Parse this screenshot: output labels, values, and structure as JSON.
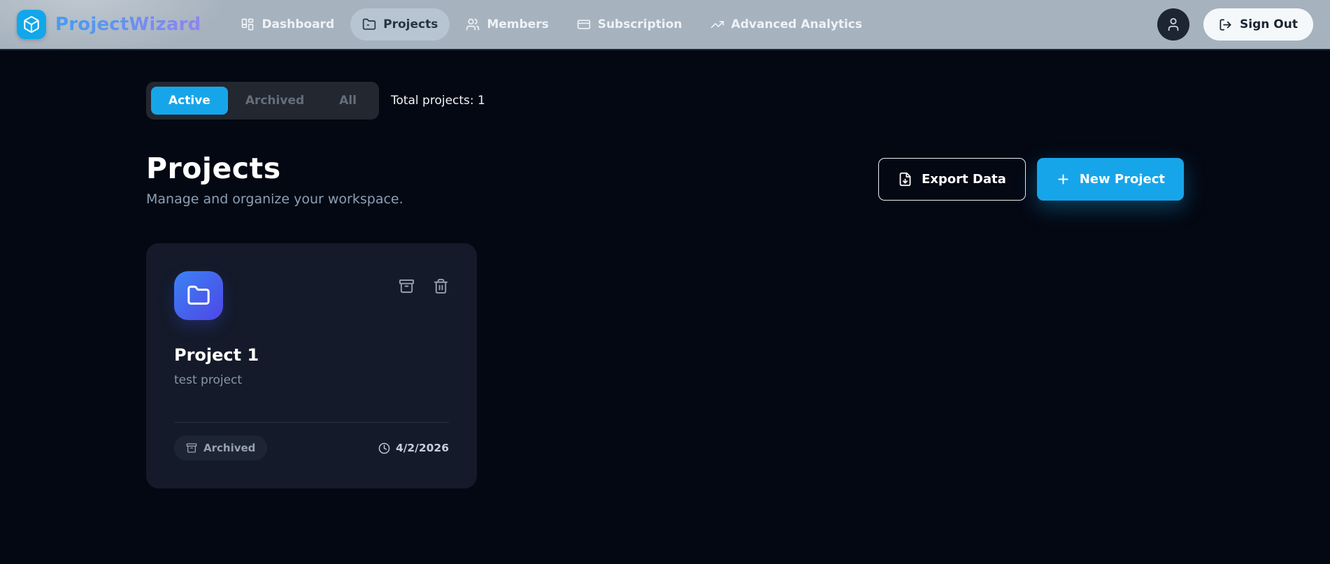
{
  "app": {
    "brand": "ProjectWizard"
  },
  "header": {
    "nav": [
      {
        "label": "Dashboard"
      },
      {
        "label": "Projects"
      },
      {
        "label": "Members"
      },
      {
        "label": "Subscription"
      },
      {
        "label": "Advanced Analytics"
      }
    ],
    "active_nav": "Projects",
    "sign_out_label": "Sign Out"
  },
  "filters": {
    "tabs": [
      {
        "label": "Active",
        "active": true
      },
      {
        "label": "Archived",
        "active": false
      },
      {
        "label": "All",
        "active": false
      }
    ],
    "total_label": "Total projects: 1"
  },
  "page": {
    "title": "Projects",
    "subtitle": "Manage and organize your workspace.",
    "buttons": {
      "export": "Export Data",
      "new_project": "New Project"
    }
  },
  "projects": [
    {
      "name": "Project 1",
      "description": "test project",
      "status_badge": "Archived",
      "date": "4/2/2026"
    }
  ],
  "icons": {
    "logo": "package-cube-icon",
    "nav": [
      "dashboard-grid-icon",
      "folder-icon",
      "users-icon",
      "credit-card-icon",
      "trending-up-icon"
    ],
    "card_actions": [
      "archive-icon",
      "trash-icon"
    ]
  },
  "colors": {
    "accent_blue": "#17a5ea",
    "logo_cyan": "#12a7ea",
    "header_bg": "#a6b2be",
    "page_bg": "#040813",
    "card_bg": "#141a29",
    "brand_gradient_start": "#4a9bf0",
    "brand_gradient_end": "#8d85f0",
    "folder_gradient_start": "#3b82f6",
    "folder_gradient_end": "#4f46e5"
  }
}
